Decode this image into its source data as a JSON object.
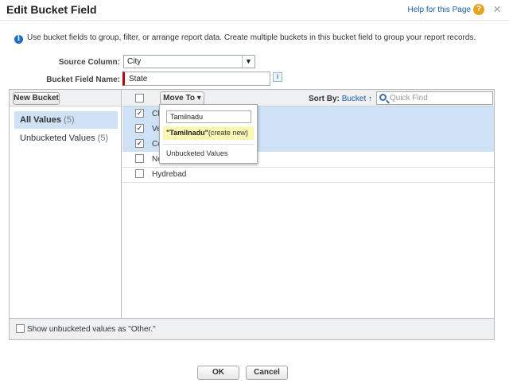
{
  "dialog": {
    "title": "Edit Bucket Field",
    "help_text": "Help for this Page",
    "help_icon": "?",
    "close_icon": "×"
  },
  "info": {
    "text": "Use bucket fields to group, filter, or arrange report data. Create multiple buckets in this bucket field to group your report records."
  },
  "form": {
    "source_label": "Source Column:",
    "source_value": "City",
    "bucket_name_label": "Bucket Field Name:",
    "bucket_name_value": "State"
  },
  "left_panel": {
    "new_bucket_label": "New Bucket",
    "items": [
      {
        "label": "All Values",
        "count": "(5)"
      },
      {
        "label": "Unbucketed Values",
        "count": "(5)"
      }
    ]
  },
  "right_panel": {
    "move_to_label": "Move To",
    "sort_by_label": "Sort By:",
    "sort_by_value": "Bucket",
    "sort_arrow": "↑",
    "quick_find_placeholder": "Quick Find",
    "rows": [
      {
        "text": "Ch",
        "checked": true
      },
      {
        "text": "Ve",
        "checked": true
      },
      {
        "text": "Co",
        "checked": true
      },
      {
        "text": "Ne",
        "checked": false
      },
      {
        "text": "Hydrebad",
        "checked": false
      }
    ]
  },
  "dropdown": {
    "input_value": "Tamilnadu",
    "create_name": "\"Tamilnadu\"",
    "create_suffix": "(create new)",
    "unbucketed_label": "Unbucketed Values"
  },
  "footer": {
    "show_other_label": "Show unbucketed values as \"Other.\""
  },
  "buttons": {
    "ok": "OK",
    "cancel": "Cancel"
  }
}
